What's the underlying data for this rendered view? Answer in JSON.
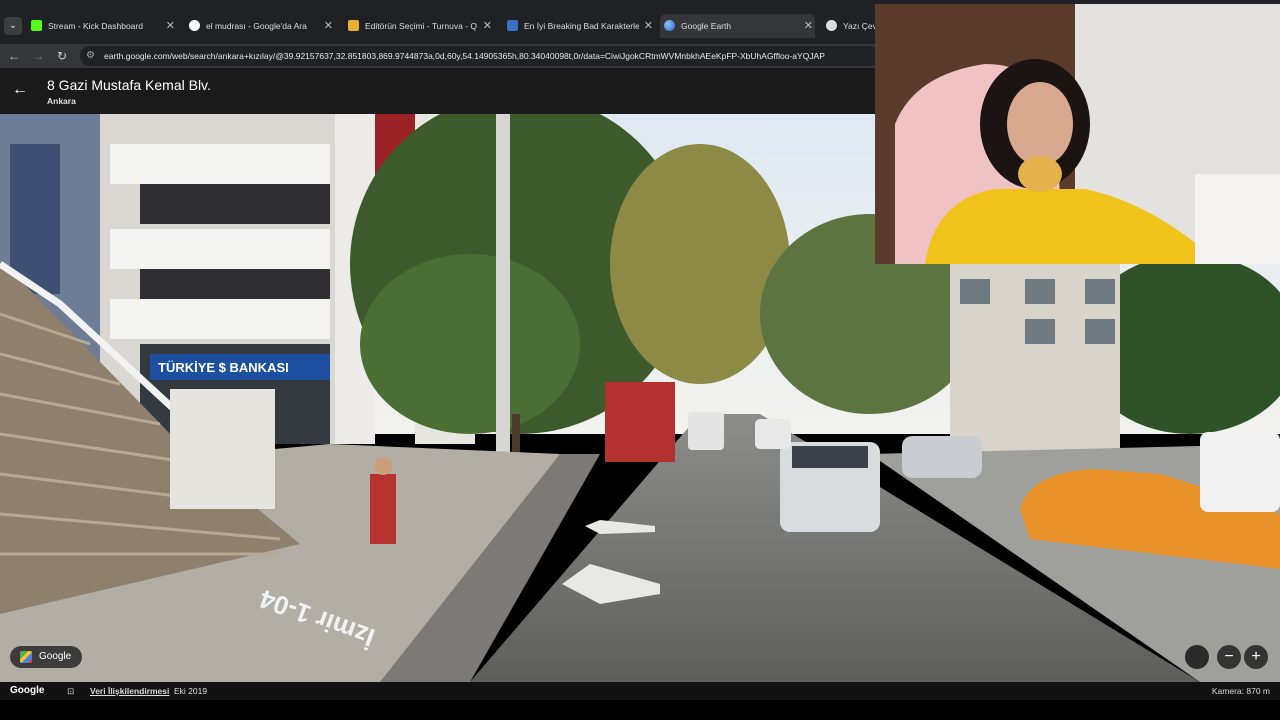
{
  "browser": {
    "tabs": [
      {
        "label": "Stream - Kick Dashboard",
        "icon_color": "#53fc18",
        "active": false
      },
      {
        "label": "el mudrası - Google'da Ara",
        "icon_color": "#ffffff",
        "active": false
      },
      {
        "label": "Editörün Seçimi - Turnuva - Q",
        "icon_color": "#e6b12e",
        "active": false
      },
      {
        "label": "En İyi Breaking Bad Karakterleri",
        "icon_color": "#3b6ec4",
        "active": false
      },
      {
        "label": "Google Earth",
        "icon_color": "#4f8ef7",
        "active": true
      },
      {
        "label": "Yazı Çevir",
        "icon_color": "#dddddd",
        "active": false
      }
    ],
    "url": "earth.google.com/web/search/ankara+kızılay/@39.92157637,32.851803,869.9744873a,0d,60y,54.14905365h,80.34040098t,0r/data=CiwiJgokCRtmWVMnbkhAEeKpFP-XbUhAGffloo-aYQJAP"
  },
  "earth": {
    "place_title": "8 Gazi Mustafa Kemal Blv.",
    "place_subtitle": "Ankara",
    "google_chip": "Google",
    "zoom_minus": "−",
    "zoom_plus": "+",
    "footer": {
      "brand": "Google",
      "zoom_icon": "⊡",
      "data_link": "Veri İlişkilendirmesi",
      "date": "Eki 2019",
      "camera": "Kamera: 870 m"
    }
  },
  "scene": {
    "bank_sign": "TÜRKİYE $ BANKASI",
    "road_text": "İzmir 1-04"
  }
}
